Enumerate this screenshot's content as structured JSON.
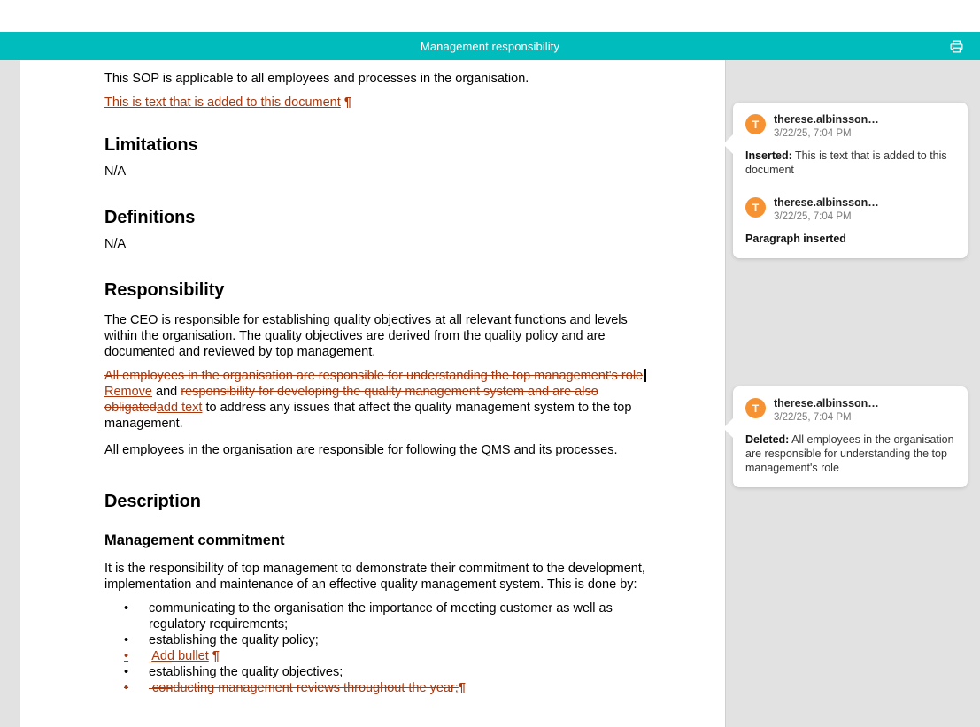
{
  "titlebar": {
    "title": "Management responsibility",
    "print_icon": "printer-icon",
    "accent_color": "#00BCBC"
  },
  "document": {
    "intro_paragraph": "This SOP is applicable to all employees and processes in the organisation.",
    "inserted_paragraph": "This is text that is added to this document",
    "pilcrow": "¶",
    "sections": [
      {
        "heading": "Limitations",
        "body": "N/A"
      },
      {
        "heading": "Definitions",
        "body": "N/A"
      }
    ],
    "responsibility": {
      "heading": "Responsibility",
      "paragraph_1": "The CEO is responsible for establishing quality objectives at all relevant functions and levels within the organisation. The quality objectives are derived from the quality policy and are documented and reviewed by top management.",
      "tracked_paragraph": {
        "deleted_1": "All employees in the organisation are responsible for understanding the top management's role",
        "inserted_1": "Remove",
        "plain_1": " and ",
        "deleted_2": "responsibility for developing the quality management system and are also obligated",
        "inserted_2": "add text",
        "plain_2": " to address any issues that affect the quality management system to the top management."
      },
      "paragraph_2": "All employees in the organisation are responsible for following the QMS and its processes."
    },
    "description": {
      "heading": "Description",
      "subheading": "Management commitment",
      "intro": "It is the responsibility of top management to demonstrate their commitment to the development, implementation and maintenance of an effective quality management system. This is done by:",
      "bullets": [
        {
          "text": "communicating to the organisation the importance of meeting customer as well as regulatory requirements;",
          "change": "none"
        },
        {
          "text": "establishing the quality policy;",
          "change": "none"
        },
        {
          "text": "Add bullet",
          "change": "inserted"
        },
        {
          "text": "establishing the quality objectives;",
          "change": "none"
        },
        {
          "text": "conducting management reviews throughout the year;",
          "change": "deleted"
        }
      ]
    }
  },
  "comments": {
    "accent_avatar_color": "#F79232",
    "change_color": "#A8390F",
    "cards": [
      {
        "entries": [
          {
            "avatar_initial": "T",
            "author": "therese.albinsson…",
            "date": "3/22/25, 7:04 PM",
            "label": "Inserted:",
            "text": " This is text that is added to this document"
          },
          {
            "avatar_initial": "T",
            "author": "therese.albinsson…",
            "date": "3/22/25, 7:04 PM",
            "label": "Paragraph inserted",
            "text": ""
          }
        ]
      },
      {
        "entries": [
          {
            "avatar_initial": "T",
            "author": "therese.albinsson…",
            "date": "3/22/25, 7:04 PM",
            "label": "Deleted:",
            "text": " All employees in the organisation are responsible for understanding the top management's role"
          }
        ]
      }
    ]
  }
}
